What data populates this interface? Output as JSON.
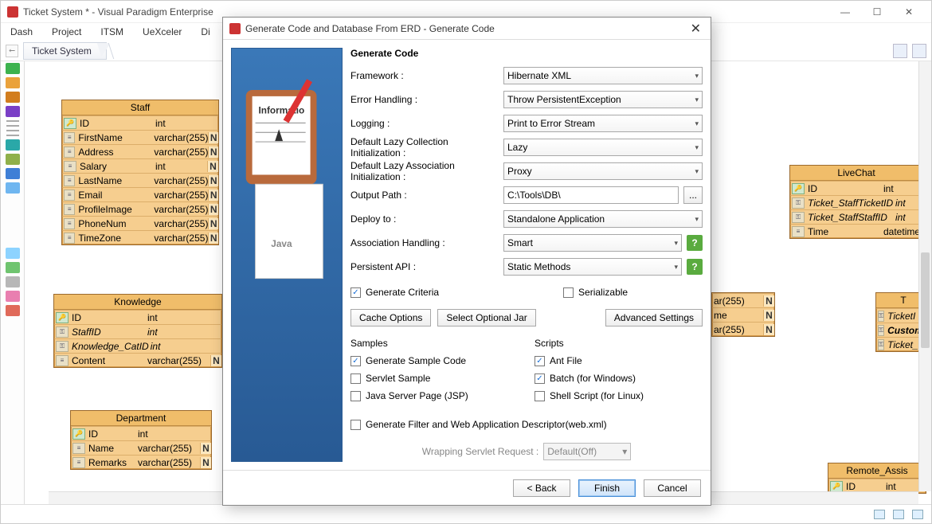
{
  "window": {
    "title": "Ticket System * - Visual Paradigm Enterprise"
  },
  "menubar": [
    "Dash",
    "Project",
    "ITSM",
    "UeXceler",
    "Di"
  ],
  "breadcrumb": {
    "item": "Ticket System"
  },
  "entities": {
    "staff": {
      "name": "Staff",
      "cols": [
        {
          "pk": true,
          "name": "ID",
          "type": "int",
          "n": false
        },
        {
          "name": "FirstName",
          "type": "varchar(255)",
          "n": true
        },
        {
          "name": "Address",
          "type": "varchar(255)",
          "n": true
        },
        {
          "name": "Salary",
          "type": "int",
          "n": true
        },
        {
          "name": "LastName",
          "type": "varchar(255)",
          "n": true
        },
        {
          "name": "Email",
          "type": "varchar(255)",
          "n": true
        },
        {
          "name": "ProfileImage",
          "type": "varchar(255)",
          "n": true
        },
        {
          "name": "PhoneNum",
          "type": "varchar(255)",
          "n": true
        },
        {
          "name": "TimeZone",
          "type": "varchar(255)",
          "n": true
        }
      ]
    },
    "knowledge": {
      "name": "Knowledge",
      "cols": [
        {
          "pk": true,
          "name": "ID",
          "type": "int",
          "n": false
        },
        {
          "name": "StaffID",
          "type": "int",
          "n": false,
          "fk": true
        },
        {
          "name": "Knowledge_CatID",
          "type": "int",
          "n": false,
          "fk": true
        },
        {
          "name": "Content",
          "type": "varchar(255)",
          "n": true
        }
      ]
    },
    "department": {
      "name": "Department",
      "cols": [
        {
          "pk": true,
          "name": "ID",
          "type": "int",
          "n": false
        },
        {
          "name": "Name",
          "type": "varchar(255)",
          "n": true
        },
        {
          "name": "Remarks",
          "type": "varchar(255)",
          "n": true
        }
      ]
    },
    "livechat": {
      "name": "LiveChat",
      "cols": [
        {
          "pk": true,
          "name": "ID",
          "type": "int",
          "n": false
        },
        {
          "name": "Ticket_StaffTicketID",
          "type": "int",
          "n": false,
          "fk": true
        },
        {
          "name": "Ticket_StaffStaffID",
          "type": "int",
          "n": false,
          "fk": true
        },
        {
          "name": "Time",
          "type": "datetime",
          "n": false
        }
      ]
    },
    "partial": {
      "cols": [
        {
          "name": "",
          "type": "ar(255)",
          "n": true
        },
        {
          "name": "",
          "type": "me",
          "n": true
        },
        {
          "name": "",
          "type": "ar(255)",
          "n": true
        }
      ]
    },
    "ticket_right": {
      "name": "T",
      "cols": [
        {
          "name": "TicketI",
          "type": ""
        },
        {
          "name": "Custom",
          "type": "",
          "bold": true
        },
        {
          "name": "Ticket_",
          "type": ""
        }
      ]
    },
    "remote": {
      "name": "Remote_Assis",
      "cols": [
        {
          "pk": true,
          "name": "ID",
          "type": "int"
        }
      ]
    }
  },
  "dialog": {
    "title": "Generate Code and Database From ERD - Generate Code",
    "heading": "Generate Code",
    "fields": {
      "framework": {
        "label": "Framework :",
        "value": "Hibernate XML"
      },
      "error": {
        "label": "Error Handling :",
        "value": "Throw PersistentException"
      },
      "logging": {
        "label": "Logging :",
        "value": "Print to Error Stream"
      },
      "lazycol": {
        "label": "Default Lazy Collection Initialization :",
        "value": "Lazy"
      },
      "lazyassoc": {
        "label": "Default Lazy Association Initialization :",
        "value": "Proxy"
      },
      "output": {
        "label": "Output Path :",
        "value": "C:\\Tools\\DB\\"
      },
      "deploy": {
        "label": "Deploy to :",
        "value": "Standalone Application"
      },
      "assoc": {
        "label": "Association Handling :",
        "value": "Smart"
      },
      "persist": {
        "label": "Persistent API :",
        "value": "Static Methods"
      }
    },
    "criteria_label": "Generate Criteria",
    "serializable_label": "Serializable",
    "cache_btn": "Cache Options",
    "jar_btn": "Select Optional Jar",
    "adv_btn": "Advanced Settings",
    "samples": {
      "heading": "Samples",
      "generate": "Generate Sample Code",
      "servlet": "Servlet Sample",
      "jsp": "Java Server Page (JSP)"
    },
    "scripts": {
      "heading": "Scripts",
      "ant": "Ant File",
      "batch": "Batch (for Windows)",
      "shell": "Shell Script (for Linux)"
    },
    "filter_label": "Generate Filter and Web Application Descriptor(web.xml)",
    "wrap": {
      "label": "Wrapping Servlet Request :",
      "value": "Default(Off)"
    },
    "back": "< Back",
    "finish": "Finish",
    "cancel": "Cancel"
  }
}
